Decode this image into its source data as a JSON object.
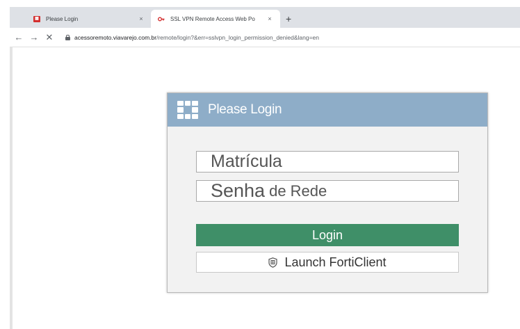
{
  "browser": {
    "tabs": [
      {
        "title": "Please Login",
        "close": "×",
        "active": false
      },
      {
        "title": "SSL VPN Remote Access Web Po",
        "close": "×",
        "active": true
      }
    ],
    "new_tab": "+",
    "nav": {
      "back": "←",
      "forward": "→",
      "stop": "✕"
    },
    "url_host": "acessoremoto.viavarejo.com.br",
    "url_path": "/remote/login?&err=sslvpn_login_permission_denied&lang=en"
  },
  "login": {
    "header_title": "Please Login",
    "username_value": "Matrícula",
    "password_value_big": "Senha",
    "password_value_small": "de Rede",
    "login_button": "Login",
    "forticlient_button": "Launch FortiClient"
  },
  "colors": {
    "header_bg": "#8eadc8",
    "login_button_bg": "#3f8f68",
    "panel_bg": "#f2f2f2"
  },
  "icons": {
    "logo": "fortinet-logo-icon",
    "forticlient": "shield-icon",
    "lock": "lock-icon"
  }
}
